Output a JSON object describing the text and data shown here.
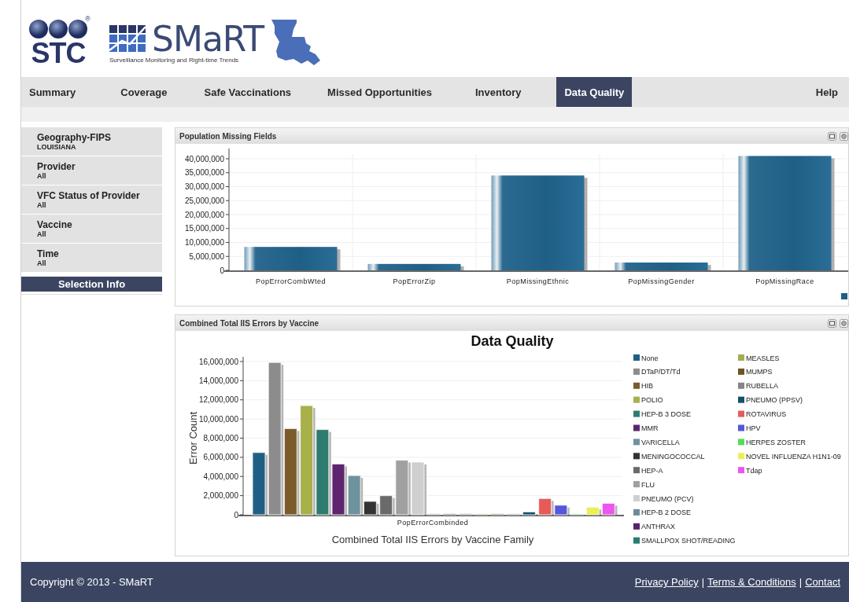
{
  "header": {
    "stc_logo": "STC",
    "registered_mark": "®",
    "app_name": "SMaRT",
    "tagline": "Surveillance Monitoring and Right-time Trends"
  },
  "nav": {
    "tabs": [
      {
        "label": "Summary",
        "selected": false
      },
      {
        "label": "Coverage",
        "selected": false
      },
      {
        "label": "Safe Vaccinations",
        "selected": false
      },
      {
        "label": "Missed Opportunities",
        "selected": false
      },
      {
        "label": "Inventory",
        "selected": false
      },
      {
        "label": "Data Quality",
        "selected": true
      }
    ],
    "help": "Help"
  },
  "sidebar": {
    "filters": [
      {
        "title": "Geography-FIPS",
        "value": "LOUISIANA"
      },
      {
        "title": "Provider",
        "value": "All"
      },
      {
        "title": "VFC Status of Provider",
        "value": "All"
      },
      {
        "title": "Vaccine",
        "value": "All"
      },
      {
        "title": "Time",
        "value": "All"
      }
    ],
    "selection_button": "Selection Info"
  },
  "panels": [
    {
      "title": "Population Missing Fields",
      "chart_data": {
        "type": "bar",
        "categories": [
          "PopErrorCombWted",
          "PopErrorZip",
          "PopMissingEthnic",
          "PopMissingGender",
          "PopMissingRace"
        ],
        "series": [
          {
            "color": "#1f5f86",
            "values": [
              8400000,
              2300000,
              34000000,
              2800000,
              41000000
            ]
          }
        ],
        "ylim": [
          0,
          42000000
        ],
        "grid": true,
        "yticks": [
          {
            "value": 0,
            "label": "0"
          },
          {
            "value": 5000000,
            "label": "5,000,000"
          },
          {
            "value": 10000000,
            "label": "10,000,000"
          },
          {
            "value": 15000000,
            "label": "15,000,000"
          },
          {
            "value": 20000000,
            "label": "20,000,000"
          },
          {
            "value": 25000000,
            "label": "25,000,000"
          },
          {
            "value": 30000000,
            "label": "30,000,000"
          },
          {
            "value": 35000000,
            "label": "35,000,000"
          },
          {
            "value": 40000000,
            "label": "40,000,000"
          }
        ]
      }
    },
    {
      "title": "Combined Total IIS Errors by Vaccine",
      "chart_data": {
        "type": "bar",
        "title": "Data Quality",
        "xlabel": "Combined Total IIS Errors by Vaccine Family",
        "ylabel": "Error Count",
        "categories": [
          "PopErrorCombinded"
        ],
        "series": [
          {
            "name": "None",
            "color": "#1f5f86",
            "values": [
              6500000
            ]
          },
          {
            "name": "DTaP/DT/Td",
            "color": "#8c8c8c",
            "values": [
              15900000
            ]
          },
          {
            "name": "HIB",
            "color": "#7a5c2a",
            "values": [
              9000000
            ]
          },
          {
            "name": "POLIO",
            "color": "#a8b04a",
            "values": [
              11400000
            ]
          },
          {
            "name": "HEP-B 3 DOSE",
            "color": "#2e7b70",
            "values": [
              8900000
            ]
          },
          {
            "name": "MMR",
            "color": "#5e2470",
            "values": [
              5300000
            ]
          },
          {
            "name": "VARICELLA",
            "color": "#6f939e",
            "values": [
              4100000
            ]
          },
          {
            "name": "MENINGOCOCCAL",
            "color": "#333333",
            "values": [
              1400000
            ]
          },
          {
            "name": "HEP-A",
            "color": "#6a6a6a",
            "values": [
              2000000
            ]
          },
          {
            "name": "FLU",
            "color": "#a0a0a0",
            "values": [
              5700000
            ]
          },
          {
            "name": "PNEUMO (PCV)",
            "color": "#cfcfcf",
            "values": [
              5500000
            ]
          },
          {
            "name": "HEP-B 2 DOSE",
            "color": "#6f8a96",
            "values": [
              100000
            ]
          },
          {
            "name": "ANTHRAX",
            "color": "#5a2070",
            "values": [
              100000
            ]
          },
          {
            "name": "SMALLPOX SHOT/READING",
            "color": "#2a7b72",
            "values": [
              100000
            ]
          },
          {
            "name": "MEASLES",
            "color": "#a6ac50",
            "values": [
              100000
            ]
          },
          {
            "name": "MUMPS",
            "color": "#6e5525",
            "values": [
              100000
            ]
          },
          {
            "name": "RUBELLA",
            "color": "#858585",
            "values": [
              100000
            ]
          },
          {
            "name": "PNEUMO (PPSV)",
            "color": "#14506e",
            "values": [
              300000
            ]
          },
          {
            "name": "ROTAVIRUS",
            "color": "#e85a5a",
            "values": [
              1700000
            ]
          },
          {
            "name": "HPV",
            "color": "#5555dd",
            "values": [
              1000000
            ]
          },
          {
            "name": "HERPES ZOSTER",
            "color": "#55dd55",
            "values": [
              100000
            ]
          },
          {
            "name": "NOVEL INFLUENZA H1N1-09",
            "color": "#eeee55",
            "values": [
              800000
            ]
          },
          {
            "name": "Tdap",
            "color": "#ee55ee",
            "values": [
              1200000
            ]
          }
        ],
        "ylim": [
          0,
          16000000
        ],
        "grid": true,
        "legend": true,
        "yticks": [
          {
            "value": 0,
            "label": "0"
          },
          {
            "value": 2000000,
            "label": "2,000,000"
          },
          {
            "value": 4000000,
            "label": "4,000,000"
          },
          {
            "value": 6000000,
            "label": "6,000,000"
          },
          {
            "value": 8000000,
            "label": "8,000,000"
          },
          {
            "value": 10000000,
            "label": "10,000,000"
          },
          {
            "value": 12000000,
            "label": "12,000,000"
          },
          {
            "value": 14000000,
            "label": "14,000,000"
          },
          {
            "value": 16000000,
            "label": "16,000,000"
          }
        ]
      }
    }
  ],
  "footer": {
    "copyright": "Copyright © 2013 - SMaRT",
    "links": [
      "Privacy Policy",
      "Terms & Conditions",
      "Contact"
    ],
    "separators": [
      "|",
      "|"
    ]
  }
}
